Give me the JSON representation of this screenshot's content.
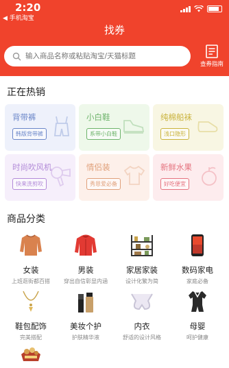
{
  "status": {
    "time": "2:20",
    "back_hint": "◀ 手机淘宝"
  },
  "header": {
    "title": "找券"
  },
  "search": {
    "placeholder": "输入商品名称或粘贴淘宝/天猫标题"
  },
  "guide": {
    "label": "查券指南",
    "icon": "document-list-icon"
  },
  "hot": {
    "title": "正在热销",
    "items": [
      {
        "name": "背带裤",
        "tag": "韩版背带裤",
        "color": "#6a86c9",
        "bg": "#eef1fb",
        "icon": "overalls-icon"
      },
      {
        "name": "小白鞋",
        "tag": "系带小白鞋",
        "color": "#6db36a",
        "bg": "#eef8ea",
        "icon": "sneaker-icon"
      },
      {
        "name": "纯棉船袜",
        "tag": "浅口隐形",
        "color": "#c9b23a",
        "bg": "#f8f6e3",
        "icon": "sock-icon"
      },
      {
        "name": "时尚吹风机",
        "tag": "快来洗剪吹",
        "color": "#b28ad8",
        "bg": "#f6effb",
        "icon": "hairdryer-icon"
      },
      {
        "name": "情侣装",
        "tag": "秀恩爱必备",
        "color": "#e0a07a",
        "bg": "#fdf0ea",
        "icon": "tshirt-icon"
      },
      {
        "name": "新鲜水果",
        "tag": "好吃便宜",
        "color": "#e5737f",
        "bg": "#fdecee",
        "icon": "fruit-icon"
      }
    ]
  },
  "categories": {
    "title": "商品分类",
    "items": [
      {
        "name": "女装",
        "sub": "上班逛街都百搭",
        "icon": "sweater-icon"
      },
      {
        "name": "男装",
        "sub": "穿出自信彰显内涵",
        "icon": "jacket-icon"
      },
      {
        "name": "家居家装",
        "sub": "设计化繁为简",
        "icon": "shelf-icon"
      },
      {
        "name": "数码家电",
        "sub": "家庭必备",
        "icon": "phone-icon"
      },
      {
        "name": "鞋包配饰",
        "sub": "完美搭配",
        "icon": "necklace-icon"
      },
      {
        "name": "美妆个护",
        "sub": "护肤精华液",
        "icon": "cosmetics-icon"
      },
      {
        "name": "内衣",
        "sub": "舒适的设计风格",
        "icon": "bra-icon"
      },
      {
        "name": "母婴",
        "sub": "呵护健康",
        "icon": "baby-clothes-icon"
      },
      {
        "name": "",
        "sub": "",
        "icon": "snack-icon"
      }
    ]
  }
}
